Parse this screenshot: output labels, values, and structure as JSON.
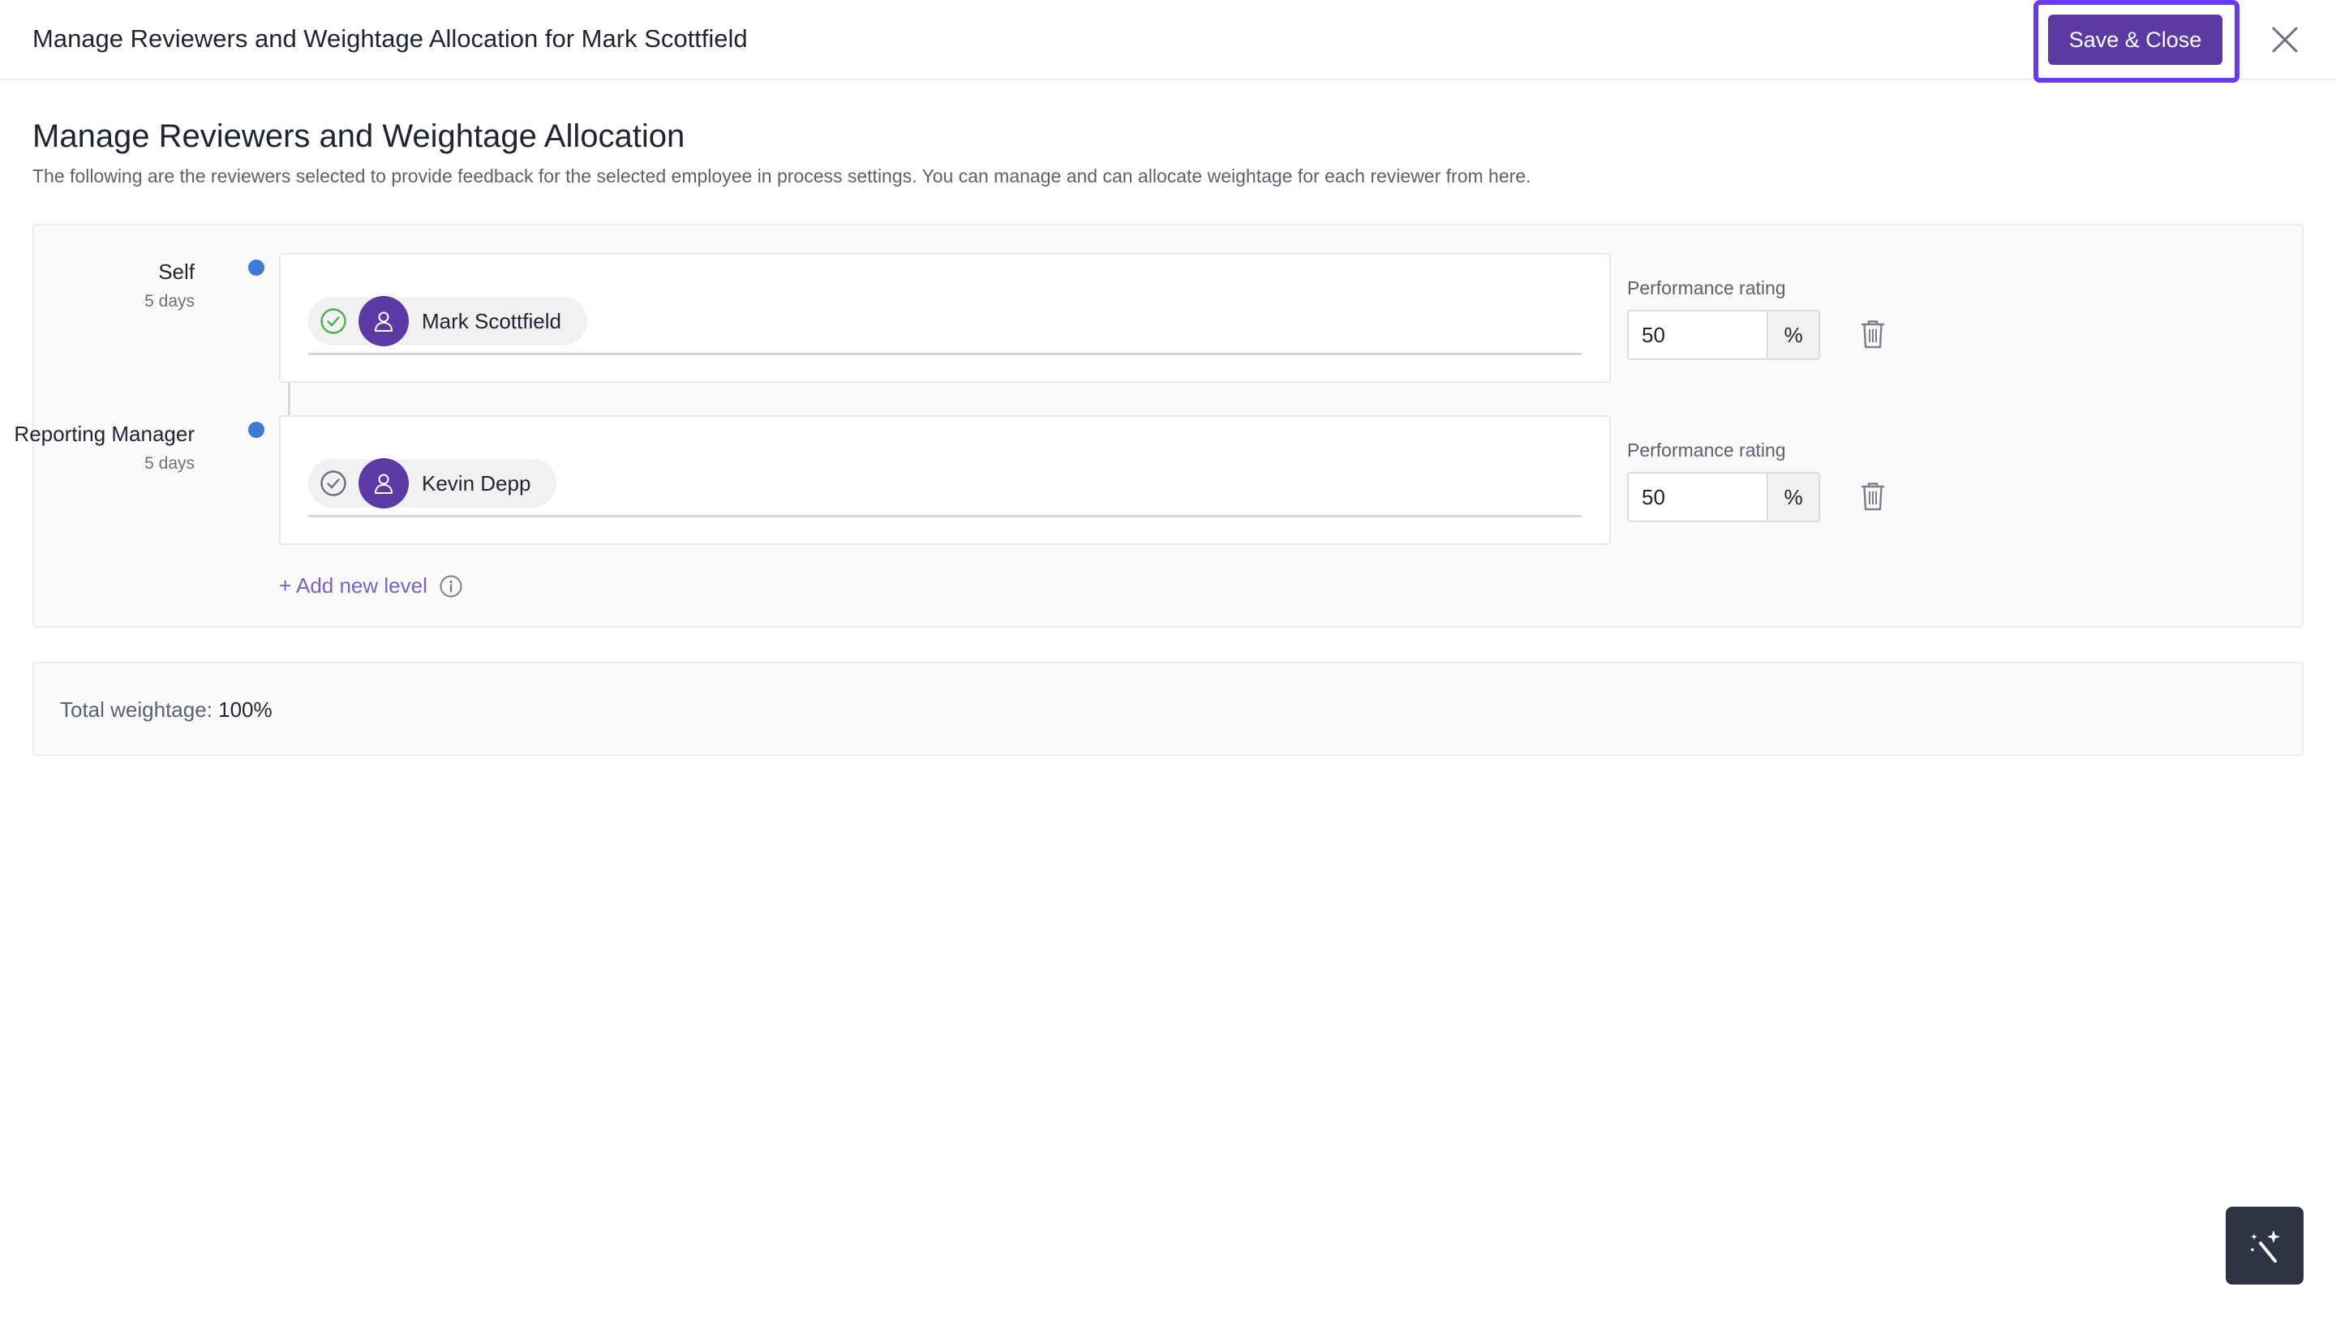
{
  "header": {
    "title": "Manage Reviewers and Weightage Allocation for Mark Scottfield",
    "save_label": "Save & Close",
    "close_icon": "close-icon"
  },
  "page": {
    "title": "Manage Reviewers and Weightage Allocation",
    "description": "The following are the reviewers selected to provide feedback for the selected employee in process settings. You can manage and can allocate weightage for each reviewer from here."
  },
  "levels": [
    {
      "label": "Self",
      "duration": "5 days",
      "reviewer": "Mark Scottfield",
      "status_icon": "check-circle-icon",
      "status_color": "#4caf50",
      "rating_label": "Performance rating",
      "rating_value": "50",
      "rating_unit": "%"
    },
    {
      "label": "Reporting Manager",
      "duration": "5 days",
      "reviewer": "Kevin Depp",
      "status_icon": "check-circle-icon",
      "status_color": "#6b7080",
      "rating_label": "Performance rating",
      "rating_value": "50",
      "rating_unit": "%"
    }
  ],
  "add_level_label": "+ Add new level",
  "total": {
    "label": "Total weightage:",
    "value": "100%"
  },
  "colors": {
    "primary": "#5b3aa4",
    "focus_outline": "#6a3cf0",
    "timeline_dot": "#3f7bd6",
    "link": "#7b63c4"
  }
}
